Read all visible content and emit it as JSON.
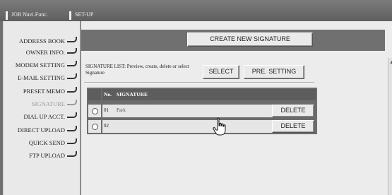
{
  "tabs": [
    {
      "label": "JOB Navi.Func."
    },
    {
      "label": "SET-UP"
    }
  ],
  "sidebar": {
    "items": [
      {
        "label": "ADDRESS BOOK"
      },
      {
        "label": "OWNER INFO."
      },
      {
        "label": "MODEM SETTING"
      },
      {
        "label": "E-MAIL SETTING"
      },
      {
        "label": "PRESET MEMO"
      },
      {
        "label": "SIGNATURE"
      },
      {
        "label": "DIAL UP ACCT."
      },
      {
        "label": "DIRECT UPLOAD"
      },
      {
        "label": "QUICK SEND"
      },
      {
        "label": "FTP UPLOAD"
      }
    ],
    "active": "SIGNATURE"
  },
  "main": {
    "create_label": "CREATE NEW SIGNATURE",
    "list_label": "SIGNATURE LIST: Preview, create, delete or select Signature",
    "select_label": "SELECT",
    "preset_label": "PRE. SETTING"
  },
  "table": {
    "headers": {
      "no": "No.",
      "signature": "SIGNATURE"
    },
    "rows": [
      {
        "no": "01",
        "signature": "Park",
        "delete_label": "DELETE"
      },
      {
        "no": "02",
        "signature": "",
        "delete_label": "DELETE"
      }
    ]
  },
  "icons": {
    "cursor": "hand-pointer-icon",
    "nav_connector": "connector-icon"
  },
  "colors": {
    "chrome": "#6f6f6f",
    "panel": "#ececec",
    "active_item": "#9a9a9a"
  }
}
